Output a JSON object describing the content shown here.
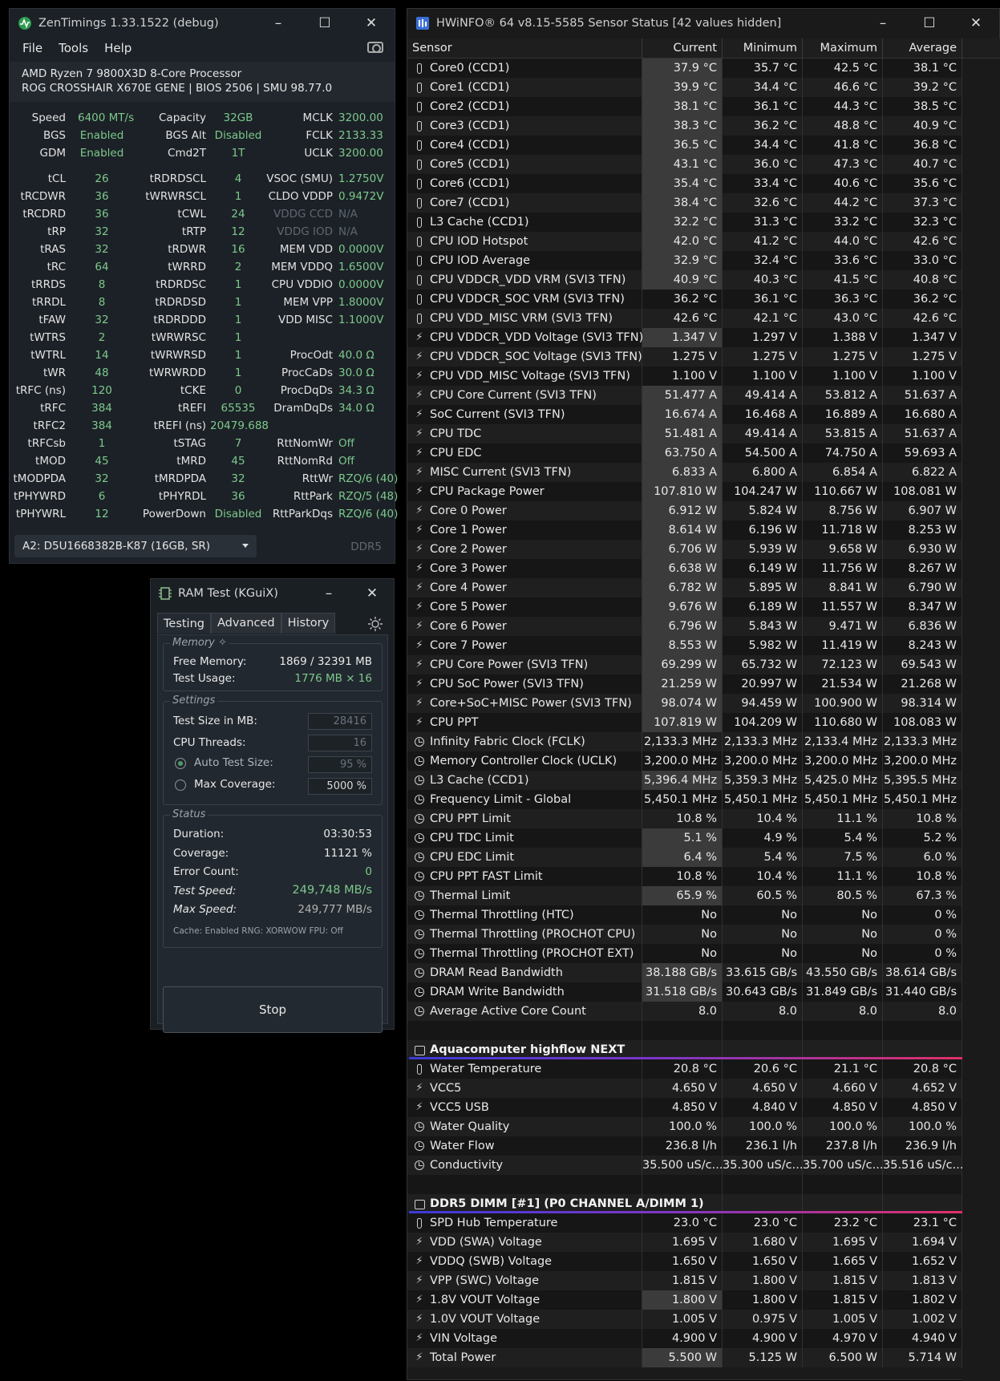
{
  "zentimings": {
    "title": "ZenTimings 1.33.1522 (debug)",
    "menu": [
      "File",
      "Tools",
      "Help"
    ],
    "cpu": "AMD Ryzen 7 9800X3D 8-Core Processor",
    "board": "ROG CROSSHAIR X670E GENE | BIOS 2506 | SMU 98.77.0",
    "rows": [
      [
        "Speed",
        "6400 MT/s",
        "Capacity",
        "32GB",
        "MCLK",
        "3200.00"
      ],
      [
        "BGS",
        "Enabled",
        "BGS Alt",
        "Disabled",
        "FCLK",
        "2133.33"
      ],
      [
        "GDM",
        "Enabled",
        "Cmd2T",
        "1T",
        "UCLK",
        "3200.00"
      ],
      [
        "tCL",
        "26",
        "tRDRDSCL",
        "4",
        "VSOC (SMU)",
        "1.2750V"
      ],
      [
        "tRCDWR",
        "36",
        "tWRWRSCL",
        "1",
        "CLDO VDDP",
        "0.9472V"
      ],
      [
        "tRCDRD",
        "36",
        "tCWL",
        "24",
        "VDDG CCD",
        "N/A"
      ],
      [
        "tRP",
        "32",
        "tRTP",
        "12",
        "VDDG IOD",
        "N/A"
      ],
      [
        "tRAS",
        "32",
        "tRDWR",
        "16",
        "MEM VDD",
        "0.0000V"
      ],
      [
        "tRC",
        "64",
        "tWRRD",
        "2",
        "MEM VDDQ",
        "1.6500V"
      ],
      [
        "tRRDS",
        "8",
        "tRDRDSC",
        "1",
        "CPU VDDIO",
        "0.0000V"
      ],
      [
        "tRRDL",
        "8",
        "tRDRDSD",
        "1",
        "MEM VPP",
        "1.8000V"
      ],
      [
        "tFAW",
        "32",
        "tRDRDDD",
        "1",
        "VDD MISC",
        "1.1000V"
      ],
      [
        "tWTRS",
        "2",
        "tWRWRSC",
        "1",
        "",
        ""
      ],
      [
        "tWTRL",
        "14",
        "tWRWRSD",
        "1",
        "ProcOdt",
        "40.0 Ω"
      ],
      [
        "tWR",
        "48",
        "tWRWRDD",
        "1",
        "ProcCaDs",
        "30.0 Ω"
      ],
      [
        "tRFC (ns)",
        "120",
        "tCKE",
        "0",
        "ProcDqDs",
        "34.3 Ω"
      ],
      [
        "tRFC",
        "384",
        "tREFI",
        "65535",
        "DramDqDs",
        "34.0 Ω"
      ],
      [
        "tRFC2",
        "384",
        "tREFI (ns)",
        "20479.688",
        "",
        ""
      ],
      [
        "tRFCsb",
        "1",
        "tSTAG",
        "7",
        "RttNomWr",
        "Off"
      ],
      [
        "tMOD",
        "45",
        "tMRD",
        "45",
        "RttNomRd",
        "Off"
      ],
      [
        "tMODPDA",
        "32",
        "tMRDPDA",
        "32",
        "RttWr",
        "RZQ/6 (40)"
      ],
      [
        "tPHYWRD",
        "6",
        "tPHYRDL",
        "36",
        "RttPark",
        "RZQ/5 (48)"
      ],
      [
        "tPHYWRL",
        "12",
        "PowerDown",
        "Disabled",
        "RttParkDqs",
        "RZQ/6 (40)"
      ]
    ],
    "dimm": "A2: D5U1668382B-K87 (16GB, SR)",
    "ddr": "DDR5"
  },
  "ramtest": {
    "title": "RAM Test (KGuiX)",
    "tabs": [
      "Testing",
      "Advanced",
      "History"
    ],
    "memory": {
      "title": "Memory",
      "free_label": "Free Memory:",
      "free_value": "1869 / 32391 MB",
      "usage_label": "Test Usage:",
      "usage_value": "1776 MB × 16"
    },
    "settings": {
      "title": "Settings",
      "size_label": "Test Size in MB:",
      "size_value": "28416",
      "threads_label": "CPU Threads:",
      "threads_value": "16",
      "auto_label": "Auto Test Size:",
      "auto_value": "95 %",
      "max_label": "Max Coverage:",
      "max_value": "5000 %"
    },
    "status": {
      "title": "Status",
      "duration_label": "Duration:",
      "duration_value": "03:30:53",
      "coverage_label": "Coverage:",
      "coverage_value": "11121 %",
      "errors_label": "Error Count:",
      "errors_value": "0",
      "speed_label": "Test Speed:",
      "speed_value": "249,748 MB/s",
      "maxspeed_label": "Max Speed:",
      "maxspeed_value": "249,777 MB/s",
      "footer": "Cache: Enabled  RNG: XORWOW  FPU: Off"
    },
    "stop": "Stop"
  },
  "hwinfo": {
    "title": "HWiNFO® 64 v8.15-5585 Sensor Status [42 values hidden]",
    "headers": [
      "Sensor",
      "Current",
      "Minimum",
      "Maximum",
      "Average"
    ],
    "rows": [
      {
        "i": "t",
        "n": "Core0 (CCD1)",
        "v": [
          "37.9 °C",
          "35.7 °C",
          "42.5 °C",
          "38.1 °C"
        ],
        "h": 1
      },
      {
        "i": "t",
        "n": "Core1 (CCD1)",
        "v": [
          "39.9 °C",
          "34.4 °C",
          "46.6 °C",
          "39.2 °C"
        ],
        "h": 1
      },
      {
        "i": "t",
        "n": "Core2 (CCD1)",
        "v": [
          "38.1 °C",
          "36.1 °C",
          "44.3 °C",
          "38.5 °C"
        ],
        "h": 1
      },
      {
        "i": "t",
        "n": "Core3 (CCD1)",
        "v": [
          "38.3 °C",
          "36.2 °C",
          "48.8 °C",
          "40.9 °C"
        ],
        "h": 1
      },
      {
        "i": "t",
        "n": "Core4 (CCD1)",
        "v": [
          "36.5 °C",
          "34.4 °C",
          "41.8 °C",
          "36.8 °C"
        ],
        "h": 1
      },
      {
        "i": "t",
        "n": "Core5 (CCD1)",
        "v": [
          "43.1 °C",
          "36.0 °C",
          "47.3 °C",
          "40.7 °C"
        ],
        "h": 1
      },
      {
        "i": "t",
        "n": "Core6 (CCD1)",
        "v": [
          "35.4 °C",
          "33.4 °C",
          "40.6 °C",
          "35.6 °C"
        ],
        "h": 1
      },
      {
        "i": "t",
        "n": "Core7 (CCD1)",
        "v": [
          "38.4 °C",
          "32.6 °C",
          "44.2 °C",
          "37.3 °C"
        ],
        "h": 1
      },
      {
        "i": "t",
        "n": "L3 Cache (CCD1)",
        "v": [
          "32.2 °C",
          "31.3 °C",
          "33.2 °C",
          "32.3 °C"
        ],
        "h": 1
      },
      {
        "i": "t",
        "n": "CPU IOD Hotspot",
        "v": [
          "42.0 °C",
          "41.2 °C",
          "44.0 °C",
          "42.6 °C"
        ],
        "h": 1
      },
      {
        "i": "t",
        "n": "CPU IOD Average",
        "v": [
          "32.9 °C",
          "32.4 °C",
          "33.6 °C",
          "33.0 °C"
        ],
        "h": 1
      },
      {
        "i": "t",
        "n": "CPU VDDCR_VDD VRM (SVI3 TFN)",
        "v": [
          "40.9 °C",
          "40.3 °C",
          "41.5 °C",
          "40.8 °C"
        ],
        "h": 1
      },
      {
        "i": "t",
        "n": "CPU VDDCR_SOC VRM (SVI3 TFN)",
        "v": [
          "36.2 °C",
          "36.1 °C",
          "36.3 °C",
          "36.2 °C"
        ],
        "h": 0
      },
      {
        "i": "t",
        "n": "CPU VDD_MISC VRM (SVI3 TFN)",
        "v": [
          "42.6 °C",
          "42.1 °C",
          "43.0 °C",
          "42.6 °C"
        ],
        "h": 0
      },
      {
        "i": "b",
        "n": "CPU VDDCR_VDD Voltage (SVI3 TFN)",
        "v": [
          "1.347 V",
          "1.297 V",
          "1.388 V",
          "1.347 V"
        ],
        "h": 1
      },
      {
        "i": "b",
        "n": "CPU VDDCR_SOC Voltage (SVI3 TFN)",
        "v": [
          "1.275 V",
          "1.275 V",
          "1.275 V",
          "1.275 V"
        ],
        "h": 0
      },
      {
        "i": "b",
        "n": "CPU VDD_MISC Voltage (SVI3 TFN)",
        "v": [
          "1.100 V",
          "1.100 V",
          "1.100 V",
          "1.100 V"
        ],
        "h": 0
      },
      {
        "i": "b",
        "n": "CPU Core Current (SVI3 TFN)",
        "v": [
          "51.477 A",
          "49.414 A",
          "53.812 A",
          "51.637 A"
        ],
        "h": 1
      },
      {
        "i": "b",
        "n": "SoC Current (SVI3 TFN)",
        "v": [
          "16.674 A",
          "16.468 A",
          "16.889 A",
          "16.680 A"
        ],
        "h": 1
      },
      {
        "i": "b",
        "n": "CPU TDC",
        "v": [
          "51.481 A",
          "49.414 A",
          "53.815 A",
          "51.637 A"
        ],
        "h": 1
      },
      {
        "i": "b",
        "n": "CPU EDC",
        "v": [
          "63.750 A",
          "54.500 A",
          "74.750 A",
          "59.693 A"
        ],
        "h": 1
      },
      {
        "i": "b",
        "n": "MISC Current (SVI3 TFN)",
        "v": [
          "6.833 A",
          "6.800 A",
          "6.854 A",
          "6.822 A"
        ],
        "h": 1
      },
      {
        "i": "b",
        "n": "CPU Package Power",
        "v": [
          "107.810 W",
          "104.247 W",
          "110.667 W",
          "108.081 W"
        ],
        "h": 1
      },
      {
        "i": "b",
        "n": "Core 0 Power",
        "v": [
          "6.912 W",
          "5.824 W",
          "8.756 W",
          "6.907 W"
        ],
        "h": 1
      },
      {
        "i": "b",
        "n": "Core 1 Power",
        "v": [
          "8.614 W",
          "6.196 W",
          "11.718 W",
          "8.253 W"
        ],
        "h": 1
      },
      {
        "i": "b",
        "n": "Core 2 Power",
        "v": [
          "6.706 W",
          "5.939 W",
          "9.658 W",
          "6.930 W"
        ],
        "h": 1
      },
      {
        "i": "b",
        "n": "Core 3 Power",
        "v": [
          "6.638 W",
          "6.149 W",
          "11.756 W",
          "8.267 W"
        ],
        "h": 1
      },
      {
        "i": "b",
        "n": "Core 4 Power",
        "v": [
          "6.782 W",
          "5.895 W",
          "8.841 W",
          "6.790 W"
        ],
        "h": 1
      },
      {
        "i": "b",
        "n": "Core 5 Power",
        "v": [
          "9.676 W",
          "6.189 W",
          "11.557 W",
          "8.347 W"
        ],
        "h": 1
      },
      {
        "i": "b",
        "n": "Core 6 Power",
        "v": [
          "6.796 W",
          "5.843 W",
          "9.471 W",
          "6.836 W"
        ],
        "h": 1
      },
      {
        "i": "b",
        "n": "Core 7 Power",
        "v": [
          "8.553 W",
          "5.982 W",
          "11.419 W",
          "8.243 W"
        ],
        "h": 1
      },
      {
        "i": "b",
        "n": "CPU Core Power (SVI3 TFN)",
        "v": [
          "69.299 W",
          "65.732 W",
          "72.123 W",
          "69.543 W"
        ],
        "h": 1
      },
      {
        "i": "b",
        "n": "CPU SoC Power (SVI3 TFN)",
        "v": [
          "21.259 W",
          "20.997 W",
          "21.534 W",
          "21.268 W"
        ],
        "h": 1
      },
      {
        "i": "b",
        "n": "Core+SoC+MISC Power (SVI3 TFN)",
        "v": [
          "98.074 W",
          "94.459 W",
          "100.900 W",
          "98.314 W"
        ],
        "h": 1
      },
      {
        "i": "b",
        "n": "CPU PPT",
        "v": [
          "107.819 W",
          "104.209 W",
          "110.680 W",
          "108.083 W"
        ],
        "h": 1
      },
      {
        "i": "c",
        "n": "Infinity Fabric Clock (FCLK)",
        "v": [
          "2,133.3 MHz",
          "2,133.3 MHz",
          "2,133.4 MHz",
          "2,133.3 MHz"
        ],
        "h": 0
      },
      {
        "i": "c",
        "n": "Memory Controller Clock (UCLK)",
        "v": [
          "3,200.0 MHz",
          "3,200.0 MHz",
          "3,200.0 MHz",
          "3,200.0 MHz"
        ],
        "h": 0
      },
      {
        "i": "c",
        "n": "L3 Cache (CCD1)",
        "v": [
          "5,396.4 MHz",
          "5,359.3 MHz",
          "5,425.0 MHz",
          "5,395.5 MHz"
        ],
        "h": 1
      },
      {
        "i": "c",
        "n": "Frequency Limit - Global",
        "v": [
          "5,450.1 MHz",
          "5,450.1 MHz",
          "5,450.1 MHz",
          "5,450.1 MHz"
        ],
        "h": 0
      },
      {
        "i": "c",
        "n": "CPU PPT Limit",
        "v": [
          "10.8 %",
          "10.4 %",
          "11.1 %",
          "10.8 %"
        ],
        "h": 0
      },
      {
        "i": "c",
        "n": "CPU TDC Limit",
        "v": [
          "5.1 %",
          "4.9 %",
          "5.4 %",
          "5.2 %"
        ],
        "h": 1
      },
      {
        "i": "c",
        "n": "CPU EDC Limit",
        "v": [
          "6.4 %",
          "5.4 %",
          "7.5 %",
          "6.0 %"
        ],
        "h": 1
      },
      {
        "i": "c",
        "n": "CPU PPT FAST Limit",
        "v": [
          "10.8 %",
          "10.4 %",
          "11.1 %",
          "10.8 %"
        ],
        "h": 0
      },
      {
        "i": "c",
        "n": "Thermal Limit",
        "v": [
          "65.9 %",
          "60.5 %",
          "80.5 %",
          "67.3 %"
        ],
        "h": 1
      },
      {
        "i": "c",
        "n": "Thermal Throttling (HTC)",
        "v": [
          "No",
          "No",
          "No",
          "0 %"
        ],
        "h": 0
      },
      {
        "i": "c",
        "n": "Thermal Throttling (PROCHOT CPU)",
        "v": [
          "No",
          "No",
          "No",
          "0 %"
        ],
        "h": 0
      },
      {
        "i": "c",
        "n": "Thermal Throttling (PROCHOT EXT)",
        "v": [
          "No",
          "No",
          "No",
          "0 %"
        ],
        "h": 0
      },
      {
        "i": "c",
        "n": "DRAM Read Bandwidth",
        "v": [
          "38.188 GB/s",
          "33.615 GB/s",
          "43.550 GB/s",
          "38.614 GB/s"
        ],
        "h": 1
      },
      {
        "i": "c",
        "n": "DRAM Write Bandwidth",
        "v": [
          "31.518 GB/s",
          "30.643 GB/s",
          "31.849 GB/s",
          "31.440 GB/s"
        ],
        "h": 1
      },
      {
        "i": "c",
        "n": "Average Active Core Count",
        "v": [
          "8.0",
          "8.0",
          "8.0",
          "8.0"
        ],
        "h": 0
      },
      {
        "i": "x",
        "n": "",
        "v": [
          "",
          "",
          "",
          ""
        ],
        "h": 0
      },
      {
        "i": "g",
        "n": "Aquacomputer highflow NEXT",
        "v": [
          "",
          "",
          "",
          ""
        ],
        "h": 0
      },
      {
        "i": "t",
        "n": "Water Temperature",
        "v": [
          "20.8 °C",
          "20.6 °C",
          "21.1 °C",
          "20.8 °C"
        ],
        "h": 0
      },
      {
        "i": "b",
        "n": "VCC5",
        "v": [
          "4.650 V",
          "4.650 V",
          "4.660 V",
          "4.652 V"
        ],
        "h": 0
      },
      {
        "i": "b",
        "n": "VCC5 USB",
        "v": [
          "4.850 V",
          "4.840 V",
          "4.850 V",
          "4.850 V"
        ],
        "h": 0
      },
      {
        "i": "c",
        "n": "Water Quality",
        "v": [
          "100.0 %",
          "100.0 %",
          "100.0 %",
          "100.0 %"
        ],
        "h": 0
      },
      {
        "i": "c",
        "n": "Water Flow",
        "v": [
          "236.8 l/h",
          "236.1 l/h",
          "237.8 l/h",
          "236.9 l/h"
        ],
        "h": 0
      },
      {
        "i": "c",
        "n": "Conductivity",
        "v": [
          "35.500 uS/c...",
          "35.300 uS/c...",
          "35.700 uS/c...",
          "35.516 uS/c..."
        ],
        "h": 0
      },
      {
        "i": "x",
        "n": "",
        "v": [
          "",
          "",
          "",
          ""
        ],
        "h": 0
      },
      {
        "i": "g",
        "n": "DDR5 DIMM [#1] (P0 CHANNEL A/DIMM 1)",
        "v": [
          "",
          "",
          "",
          ""
        ],
        "h": 0
      },
      {
        "i": "t",
        "n": "SPD Hub Temperature",
        "v": [
          "23.0 °C",
          "23.0 °C",
          "23.2 °C",
          "23.1 °C"
        ],
        "h": 0
      },
      {
        "i": "b",
        "n": "VDD (SWA) Voltage",
        "v": [
          "1.695 V",
          "1.680 V",
          "1.695 V",
          "1.694 V"
        ],
        "h": 0
      },
      {
        "i": "b",
        "n": "VDDQ (SWB) Voltage",
        "v": [
          "1.650 V",
          "1.650 V",
          "1.665 V",
          "1.652 V"
        ],
        "h": 0
      },
      {
        "i": "b",
        "n": "VPP (SWC) Voltage",
        "v": [
          "1.815 V",
          "1.800 V",
          "1.815 V",
          "1.813 V"
        ],
        "h": 0
      },
      {
        "i": "b",
        "n": "1.8V VOUT Voltage",
        "v": [
          "1.800 V",
          "1.800 V",
          "1.815 V",
          "1.802 V"
        ],
        "h": 1
      },
      {
        "i": "b",
        "n": "1.0V VOUT Voltage",
        "v": [
          "1.005 V",
          "0.975 V",
          "1.005 V",
          "1.002 V"
        ],
        "h": 0
      },
      {
        "i": "b",
        "n": "VIN Voltage",
        "v": [
          "4.900 V",
          "4.900 V",
          "4.970 V",
          "4.940 V"
        ],
        "h": 0
      },
      {
        "i": "b",
        "n": "Total Power",
        "v": [
          "5.500 W",
          "5.125 W",
          "6.500 W",
          "5.714 W"
        ],
        "h": 1
      }
    ]
  }
}
